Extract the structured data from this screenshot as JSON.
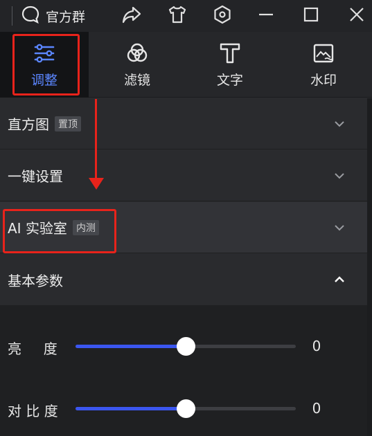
{
  "titlebar": {
    "group_label": "官方群"
  },
  "tabs": [
    {
      "label": "调整",
      "icon": "sliders-icon",
      "active": true
    },
    {
      "label": "滤镜",
      "icon": "filter-circles-icon",
      "active": false
    },
    {
      "label": "文字",
      "icon": "text-t-icon",
      "active": false
    },
    {
      "label": "水印",
      "icon": "watermark-image-icon",
      "active": false
    }
  ],
  "sections": {
    "histogram": {
      "title": "直方图",
      "badge": "置顶"
    },
    "one_click": {
      "title": "一键设置"
    },
    "ai_lab": {
      "title": "AI 实验室",
      "badge": "内测"
    },
    "basic": {
      "title": "基本参数"
    }
  },
  "params": [
    {
      "label": "亮     度",
      "value": "0",
      "level": 0.5
    },
    {
      "label": "对 比 度",
      "value": "0",
      "level": 0.5
    }
  ],
  "colors": {
    "accent": "#3b56f0",
    "active_tab_text": "#5b86ff",
    "annotation": "#e8231b"
  }
}
